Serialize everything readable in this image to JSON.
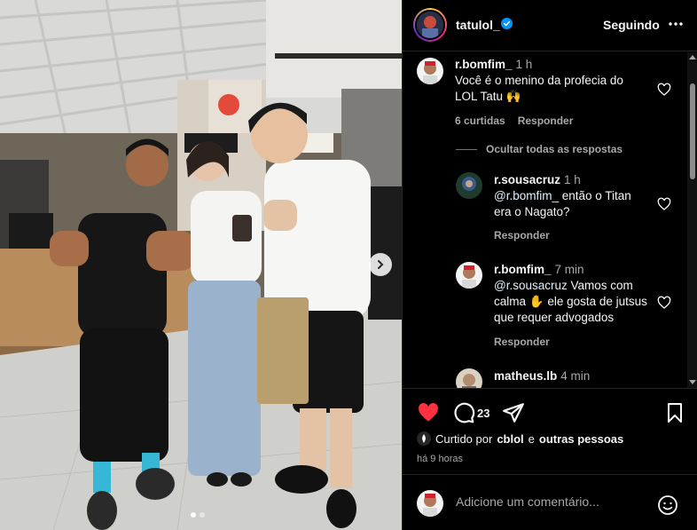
{
  "post": {
    "username": "tatulol_",
    "follow_label": "Seguindo",
    "comment_count": "23",
    "liked_by_prefix": "Curtido por",
    "liked_by_user": "cblol",
    "liked_by_conj": "e",
    "liked_by_others": "outras pessoas",
    "time_ago": "há 9 horas",
    "comment_placeholder": "Adicione um comentário...",
    "carousel": {
      "slide_count": 2,
      "active_slide": 1
    }
  },
  "comments": [
    {
      "user": "r.bomfim_",
      "time": "1 h",
      "text_line1": "Você é o menino da profecia do",
      "text_line2": "LOL Tatu 🙌",
      "likes": "6 curtidas",
      "reply_label": "Responder",
      "hide_replies": "Ocultar todas as respostas",
      "replies": [
        {
          "user": "r.sousacruz",
          "time": "1 h",
          "mention": "@r.bomfim_",
          "text_line1": " então o Titan",
          "text_line2": "era o Nagato?",
          "reply_label": "Responder"
        },
        {
          "user": "r.bomfim_",
          "time": "7 min",
          "mention": "@r.sousacruz",
          "text_line1": " Vamos com",
          "text_line2": "calma ✋ ele gosta de jutsus",
          "text_line3": "que requer advogados",
          "reply_label": "Responder"
        },
        {
          "user": "matheus.lb",
          "time": "4 min"
        }
      ]
    }
  ],
  "colors": {
    "background": "#000000",
    "text": "#f5f5f5",
    "secondary_text": "#a8a8a8",
    "like_red": "#ff3040",
    "mention_blue": "#e0f1ff",
    "verified_blue": "#0095f6"
  },
  "icons": [
    "verified-badge-icon",
    "more-icon",
    "heart-icon",
    "comment-icon",
    "share-icon",
    "bookmark-icon",
    "emoji-icon",
    "chevron-right-icon"
  ]
}
